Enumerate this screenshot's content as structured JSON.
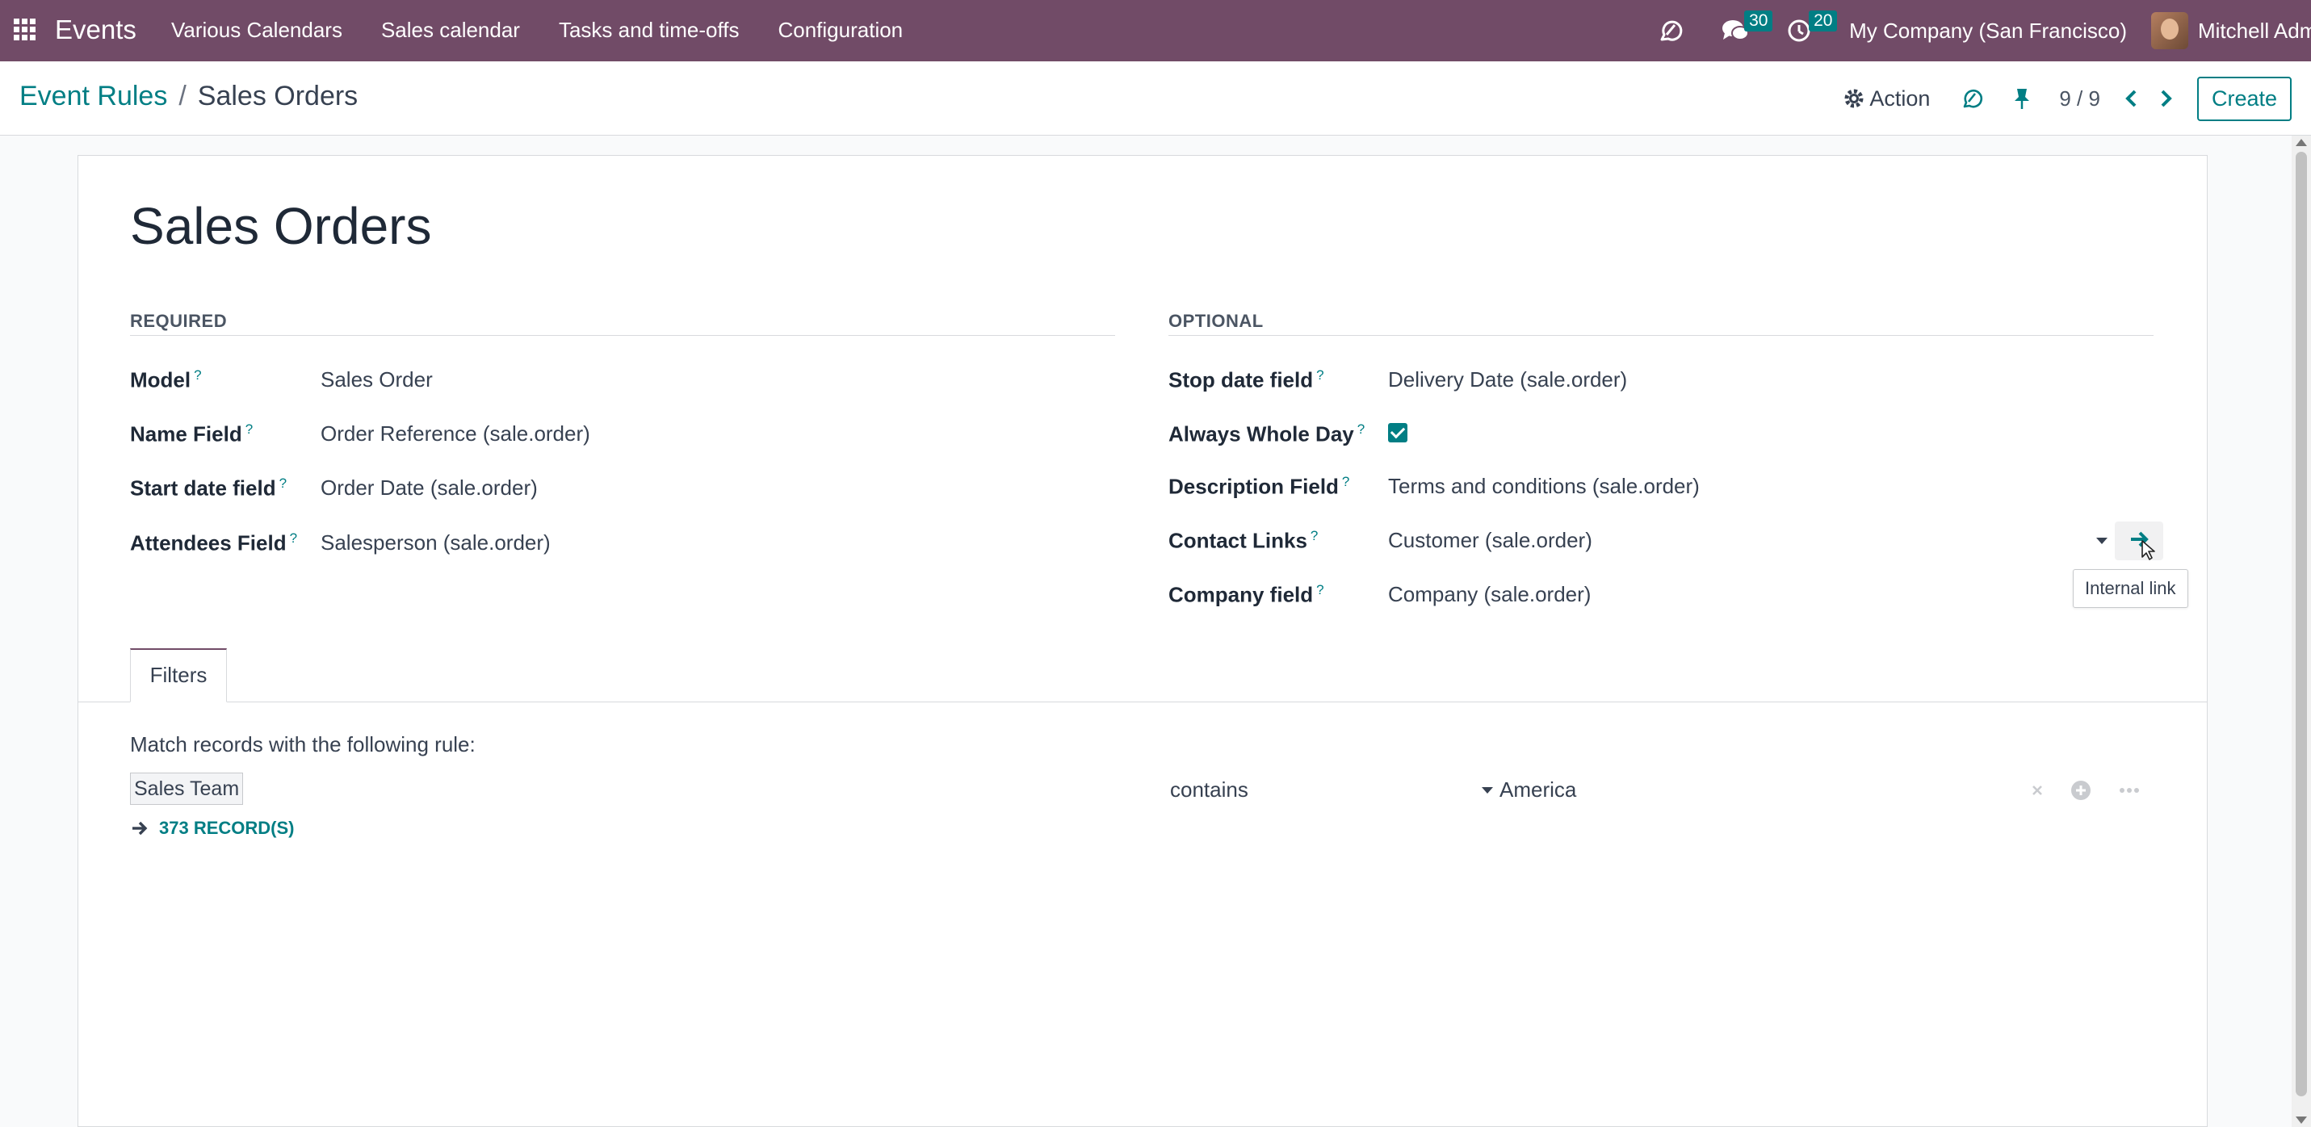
{
  "navbar": {
    "app_name": "Events",
    "menu": [
      "Various Calendars",
      "Sales calendar",
      "Tasks and time-offs",
      "Configuration"
    ],
    "messages_count": "30",
    "activities_count": "20",
    "company": "My Company (San Francisco)",
    "user": "Mitchell Adm"
  },
  "control_panel": {
    "breadcrumb_parent": "Event Rules",
    "breadcrumb_separator": "/",
    "breadcrumb_current": "Sales Orders",
    "action_label": "Action",
    "pager": "9 / 9",
    "create_label": "Create"
  },
  "form": {
    "title": "Sales Orders",
    "required": {
      "heading": "REQUIRED",
      "fields": [
        {
          "label": "Model",
          "value": "Sales Order"
        },
        {
          "label": "Name Field",
          "value": "Order Reference (sale.order)"
        },
        {
          "label": "Start date field",
          "value": "Order Date (sale.order)"
        },
        {
          "label": "Attendees Field",
          "value": "Salesperson (sale.order)"
        }
      ]
    },
    "optional": {
      "heading": "OPTIONAL",
      "fields": [
        {
          "label": "Stop date field",
          "value": "Delivery Date (sale.order)"
        },
        {
          "label": "Always Whole Day",
          "value": ""
        },
        {
          "label": "Description Field",
          "value": "Terms and conditions (sale.order)"
        },
        {
          "label": "Contact Links",
          "value": "Customer (sale.order)"
        },
        {
          "label": "Company field",
          "value": "Company (sale.order)"
        }
      ],
      "always_whole_day_checked": true
    },
    "help_mark": "?",
    "tooltip": "Internal link"
  },
  "tabs": [
    {
      "label": "Filters"
    }
  ],
  "filters": {
    "intro": "Match records with the following rule:",
    "rule": {
      "field": "Sales Team",
      "operator": "contains",
      "value": "America"
    },
    "records_link": "373 RECORD(S)"
  },
  "colors": {
    "brand": "#714b67",
    "accent": "#017e84"
  }
}
